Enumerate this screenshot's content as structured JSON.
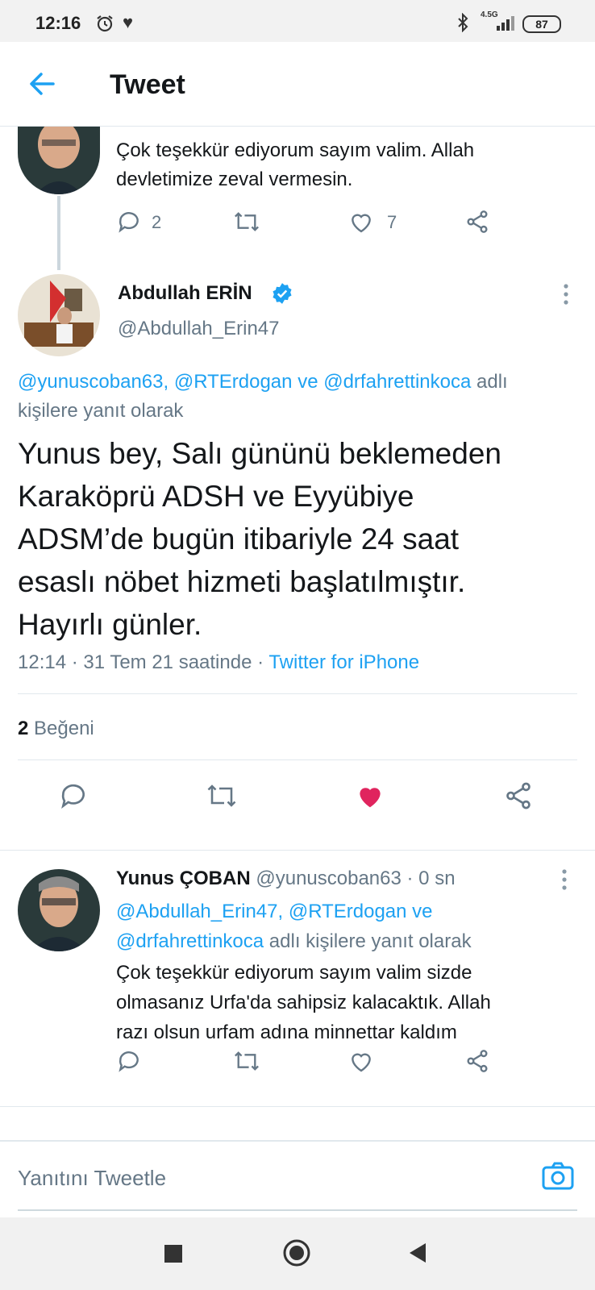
{
  "status_bar": {
    "time": "12:16",
    "network": "4.5G",
    "battery": "87"
  },
  "header": {
    "title": "Tweet"
  },
  "prev_tweet": {
    "text": "Çok teşekkür ediyorum sayım valim. Allah devletimize zeval vermesin.",
    "reply_count": "2",
    "like_count": "7"
  },
  "main_tweet": {
    "author_name": "Abdullah ERİN",
    "handle": "@Abdullah_Erin47",
    "reply_mentions": [
      "@yunuscoban63,",
      "@RTErdogan",
      "ve",
      "@drfahrettinkoca"
    ],
    "reply_suffix_1": "adlı",
    "reply_suffix_2": "kişilere yanıt olarak",
    "text_lines": [
      "Yunus bey, Salı gününü beklemeden",
      "Karaköprü ADSH ve Eyyübiye",
      "ADSM’de bugün itibariyle 24 saat",
      "esaslı nöbet hizmeti başlatılmıştır.",
      "Hayırlı günler."
    ],
    "meta": "12:14 · 31 Tem 21 saatinde ·",
    "source": "Twitter for iPhone",
    "like_count": "2",
    "like_label": "Beğeni",
    "accent": "#1da1f2",
    "like_color": "#e0245e"
  },
  "reply_tweet": {
    "author_name": "Yunus ÇOBAN",
    "handle_time": "@yunuscoban63 · 0 sn",
    "mention_1": "@Abdullah_Erin47, @RTErdogan ve",
    "mention_2": "@drfahrettinkoca",
    "reply_suffix": "adlı kişilere yanıt olarak",
    "text_lines": [
      "Çok teşekkür ediyorum sayım valim sizde",
      "olmasanız Urfa'da sahipsiz kalacaktık. Allah",
      "razı olsun urfam adına minnettar kaldım"
    ]
  },
  "reply_box": {
    "placeholder": "Yanıtını Tweetle"
  }
}
